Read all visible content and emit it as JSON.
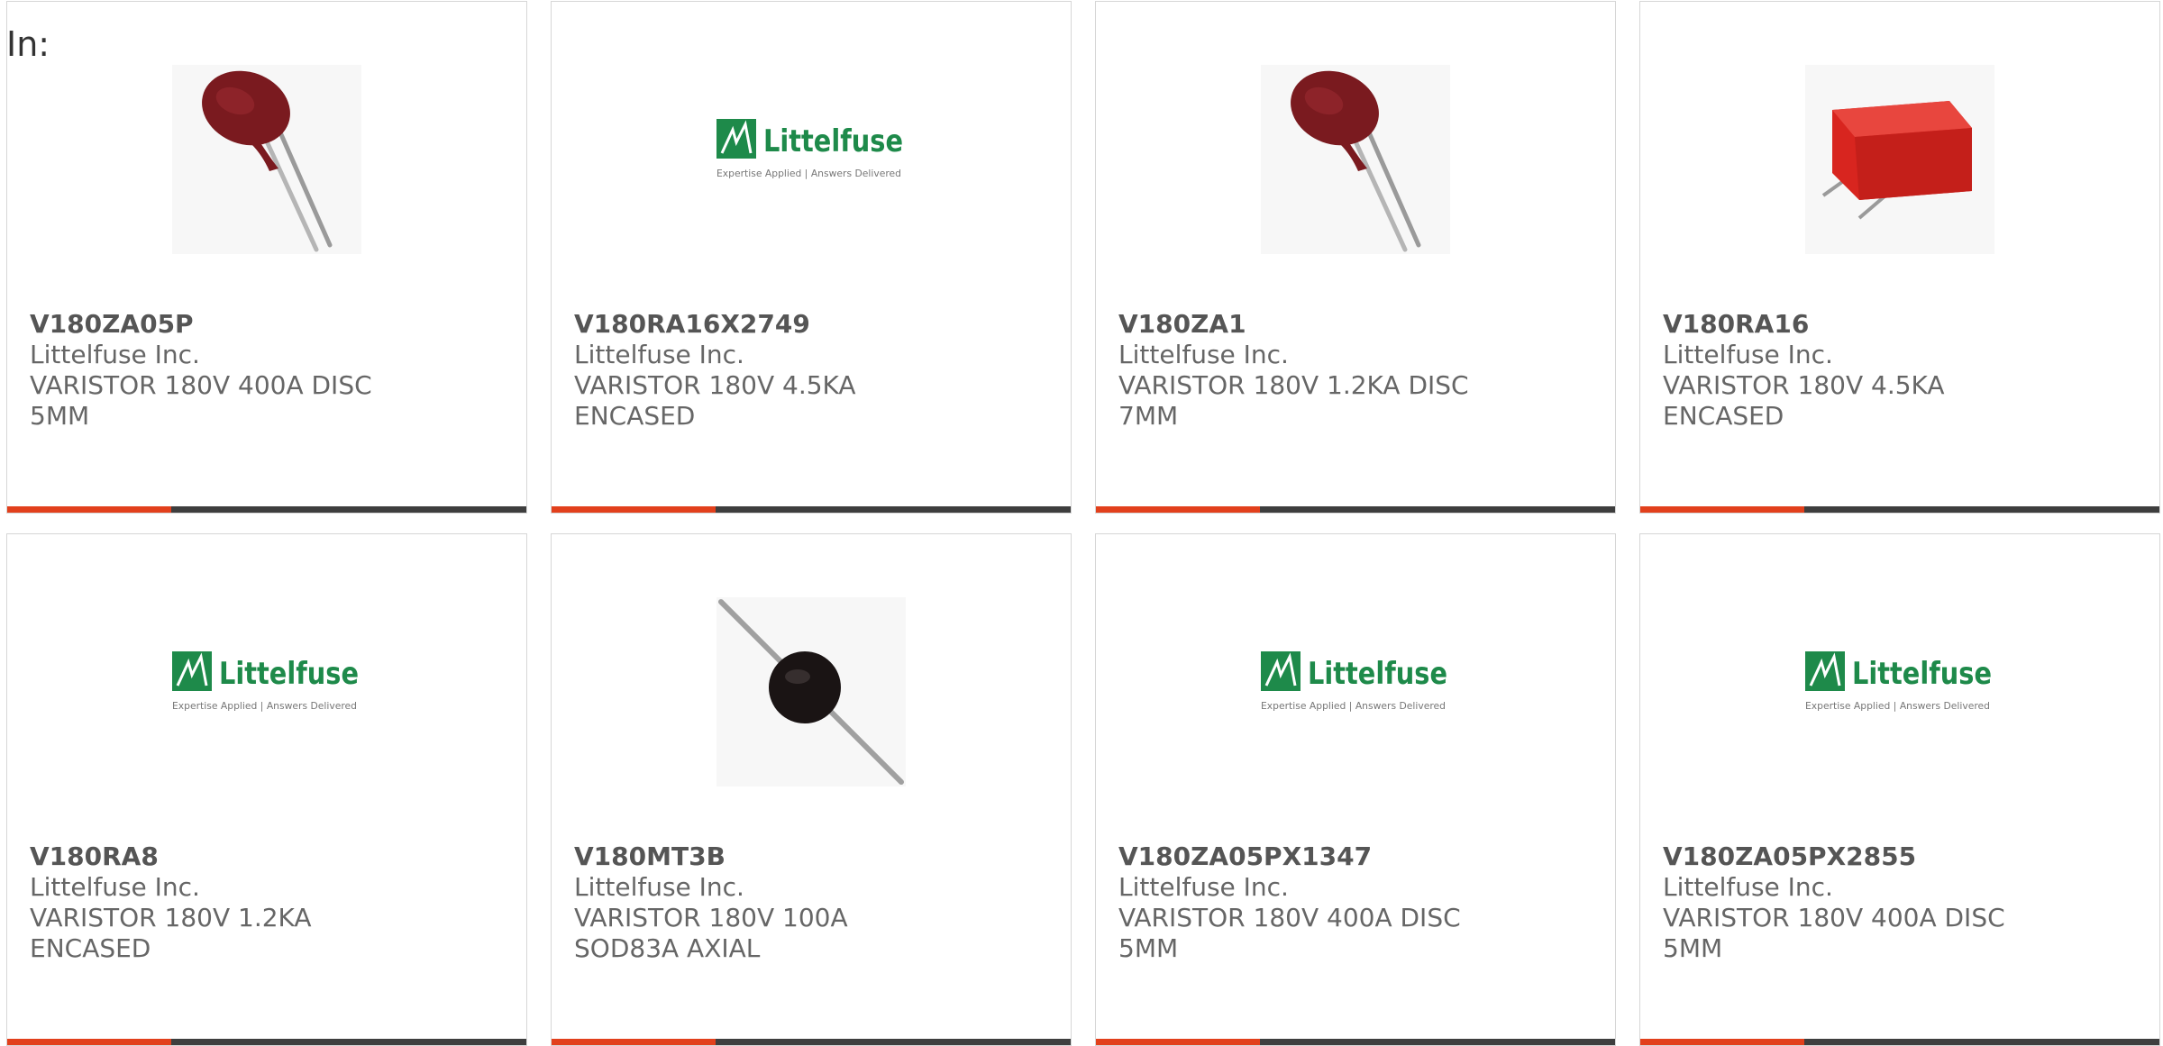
{
  "page": {
    "filter_label": "In:"
  },
  "colors": {
    "accent": "#e2401c",
    "bar_dark": "#3e3e3e",
    "logo_green": "#1e8a4a",
    "varistor_red": "#7a1a1f",
    "encased_red": "#d8251f"
  },
  "products": [
    {
      "part_number": "V180ZA05P",
      "manufacturer": "Littelfuse Inc.",
      "description": "VARISTOR 180V 400A DISC 5MM",
      "image": "radial-disc-varistor-image"
    },
    {
      "part_number": "V180RA16X2749",
      "manufacturer": "Littelfuse Inc.",
      "description": "VARISTOR 180V 4.5KA ENCASED",
      "image": "littelfuse-logo-image",
      "logo_text": "Littelfuse",
      "logo_tagline": "Expertise Applied | Answers Delivered"
    },
    {
      "part_number": "V180ZA1",
      "manufacturer": "Littelfuse Inc.",
      "description": "VARISTOR 180V 1.2KA DISC 7MM",
      "image": "radial-disc-varistor-image"
    },
    {
      "part_number": "V180RA16",
      "manufacturer": "Littelfuse Inc.",
      "description": "VARISTOR 180V 4.5KA ENCASED",
      "image": "encased-varistor-image"
    },
    {
      "part_number": "V180RA8",
      "manufacturer": "Littelfuse Inc.",
      "description": "VARISTOR 180V 1.2KA ENCASED",
      "image": "littelfuse-logo-image",
      "logo_text": "Littelfuse",
      "logo_tagline": "Expertise Applied | Answers Delivered"
    },
    {
      "part_number": "V180MT3B",
      "manufacturer": "Littelfuse Inc.",
      "description": "VARISTOR 180V 100A SOD83A AXIAL",
      "image": "axial-varistor-image"
    },
    {
      "part_number": "V180ZA05PX1347",
      "manufacturer": "Littelfuse Inc.",
      "description": "VARISTOR 180V 400A DISC 5MM",
      "image": "littelfuse-logo-image",
      "logo_text": "Littelfuse",
      "logo_tagline": "Expertise Applied | Answers Delivered"
    },
    {
      "part_number": "V180ZA05PX2855",
      "manufacturer": "Littelfuse Inc.",
      "description": "VARISTOR 180V 400A DISC 5MM",
      "image": "littelfuse-logo-image",
      "logo_text": "Littelfuse",
      "logo_tagline": "Expertise Applied | Answers Delivered"
    }
  ]
}
